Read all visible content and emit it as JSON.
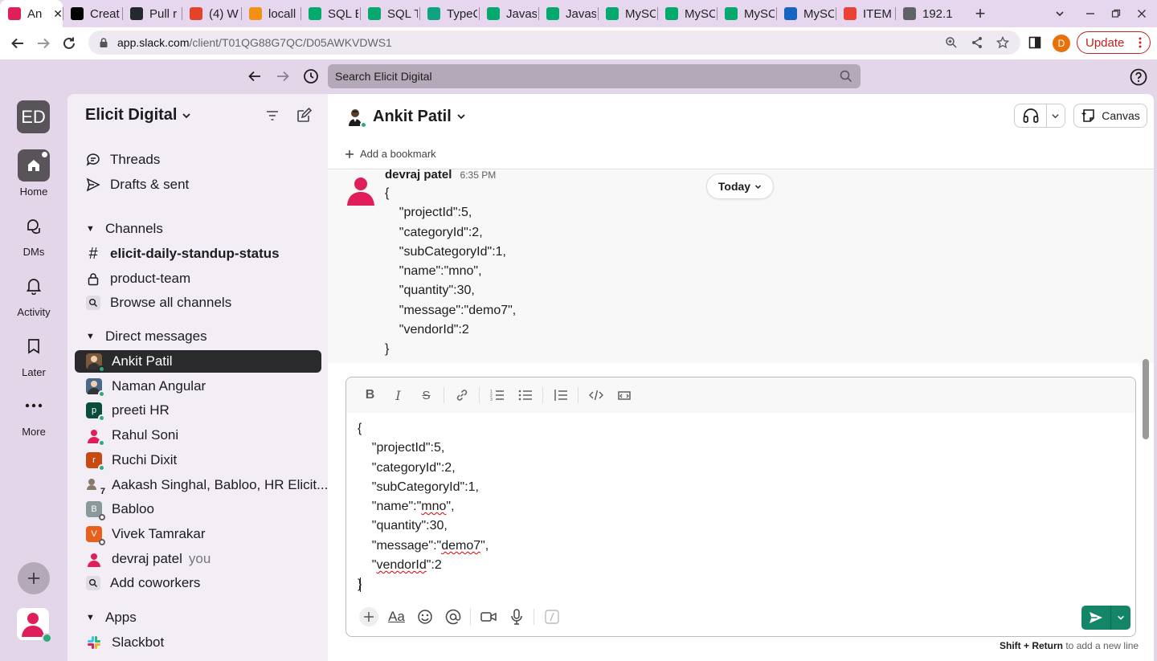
{
  "browser": {
    "tabs": [
      {
        "title": "An",
        "icon": "slack-icon",
        "color": "#e01e5a",
        "active": true
      },
      {
        "title": "Creat",
        "icon": "tab-icon",
        "color": "#000000"
      },
      {
        "title": "Pull r",
        "icon": "github-icon",
        "color": "#24292f"
      },
      {
        "title": "(4) W",
        "icon": "tab-icon",
        "color": "#e24329"
      },
      {
        "title": "locall",
        "icon": "tab-icon",
        "color": "#f29111"
      },
      {
        "title": "SQL E",
        "icon": "w3schools-icon",
        "color": "#04aa6d"
      },
      {
        "title": "SQL T",
        "icon": "w3schools-icon",
        "color": "#04aa6d"
      },
      {
        "title": "TypeC",
        "icon": "chatgpt-icon",
        "color": "#10a37f"
      },
      {
        "title": "Javas",
        "icon": "w3schools-icon",
        "color": "#04aa6d"
      },
      {
        "title": "Javas",
        "icon": "w3schools-icon",
        "color": "#04aa6d"
      },
      {
        "title": "MySC",
        "icon": "w3schools-icon",
        "color": "#04aa6d"
      },
      {
        "title": "MySC",
        "icon": "w3schools-icon",
        "color": "#04aa6d"
      },
      {
        "title": "MySC",
        "icon": "w3schools-icon",
        "color": "#04aa6d"
      },
      {
        "title": "MySC",
        "icon": "tab-icon",
        "color": "#1565c0"
      },
      {
        "title": "ITEM",
        "icon": "gmail-icon",
        "color": "#ea4335"
      },
      {
        "title": "192.1",
        "icon": "globe-icon",
        "color": "#5f6368"
      }
    ],
    "url_host": "app.slack.com",
    "url_path": "/client/T01QG88G7QC/D05AWKVDWS1",
    "profile_initial": "D",
    "update_label": "Update"
  },
  "slack": {
    "search_placeholder": "Search Elicit Digital",
    "workspace_initials": "ED",
    "rail": [
      {
        "label": "Home",
        "icon": "home-icon"
      },
      {
        "label": "DMs",
        "icon": "dms-icon"
      },
      {
        "label": "Activity",
        "icon": "bell-icon"
      },
      {
        "label": "Later",
        "icon": "bookmark-icon"
      },
      {
        "label": "More",
        "icon": "more-icon"
      }
    ],
    "sidebar": {
      "workspace_name": "Elicit Digital",
      "threads": "Threads",
      "drafts": "Drafts & sent",
      "channels_header": "Channels",
      "channels": [
        {
          "label": "elicit-daily-standup-status",
          "icon": "hash-icon",
          "bold": true
        },
        {
          "label": "product-team",
          "icon": "lock-icon",
          "bold": false
        },
        {
          "label": "Browse all channels",
          "icon": "search-icon",
          "bold": false
        }
      ],
      "dm_header": "Direct messages",
      "dms": [
        {
          "label": "Ankit Patil",
          "color": "#7a5a3a",
          "status": "#2bac76"
        },
        {
          "label": "Naman Angular",
          "color": "#4a6a8a",
          "status": "#2bac76"
        },
        {
          "label": "preeti HR",
          "color": "#0b4d3d",
          "initial": "p",
          "status": "#2bac76"
        },
        {
          "label": "Rahul Soni",
          "color": "#e01e5a",
          "status": "#2bac76"
        },
        {
          "label": "Ruchi Dixit",
          "color": "#c84a12",
          "initial": "r",
          "status": "#2bac76"
        },
        {
          "label": "Aakash Singhal, Babloo, HR Elicit...",
          "color": "#8a7a6a",
          "group": "7"
        },
        {
          "label": "Babloo",
          "color": "#8a9a9a",
          "initial": "B",
          "status": "#ffffff"
        },
        {
          "label": "Vivek Tamrakar",
          "color": "#e8601c",
          "initial": "V",
          "status": "#ffffff"
        },
        {
          "label": "devraj patel",
          "color": "#e01e5a",
          "you": "you"
        },
        {
          "label": "Add coworkers",
          "icon": "search-icon"
        }
      ],
      "apps_header": "Apps",
      "apps": [
        {
          "label": "Slackbot"
        }
      ]
    },
    "channel": {
      "title": "Ankit Patil",
      "add_bookmark": "Add a bookmark",
      "canvas_label": "Canvas",
      "today_label": "Today"
    },
    "message": {
      "author": "devraj patel",
      "time": "6:35 PM",
      "body": "{\n    \"projectId\":5,\n    \"categoryId\":2,\n    \"subCategoryId\":1,\n    \"name\":\"mno\",\n    \"quantity\":30,\n    \"message\":\"demo7\",\n    \"vendorId\":2\n}"
    },
    "composer": {
      "lines": [
        "{",
        "    \"projectId\":5,",
        "    \"categoryId\":2,",
        "    \"subCategoryId\":1,",
        "    \"name\":\"mno\",",
        "    \"quantity\":30,",
        "    \"message\":\"demo7\",",
        "    \"vendorId\":2",
        "}"
      ],
      "hint_keys": "Shift + Return",
      "hint_text": " to add a new line"
    }
  }
}
